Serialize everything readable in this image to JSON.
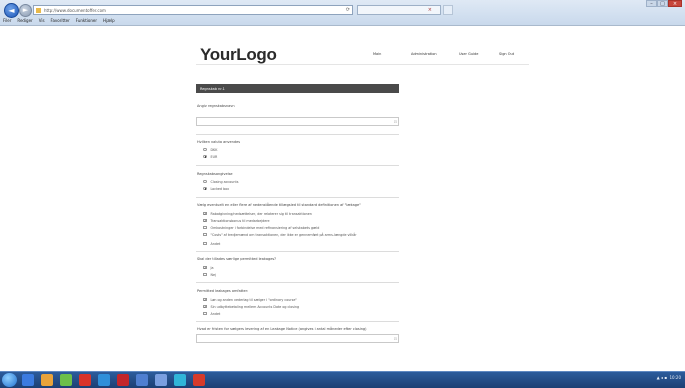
{
  "browser": {
    "back_symbol": "◄",
    "forward_symbol": "►",
    "url": "http://www.documentoffer.com",
    "tab_title": "",
    "menu": [
      "Filer",
      "Rediger",
      "Vis",
      "Favoritter",
      "Funktioner",
      "Hjælp"
    ]
  },
  "header": {
    "logo": "YourLogo",
    "nav": [
      "Main",
      "Administration",
      "User Guide",
      "Sign Out"
    ]
  },
  "form": {
    "section_title": "Regnskab nr.1",
    "q1": {
      "label": "Angiv regnskabsnavn"
    },
    "q2": {
      "label": "Hvilken valuta anvendes",
      "options": [
        "DKK",
        "EUR"
      ],
      "selected": 1
    },
    "q3": {
      "label": "Regnskabsangivelse",
      "options": [
        "Closing accounts",
        "Locked box"
      ],
      "selected": 1
    },
    "q4": {
      "label": "Vælg eventuelt en eller flere af nedenstående tillægsled til standard definitionen af \"lækage\"",
      "options": [
        {
          "text": "Rabatgivning/nedsættelser, der relaterer sig til transaktionen",
          "checked": true
        },
        {
          "text": "Transaktionsbonus til medarbejdere",
          "checked": true
        },
        {
          "text": "Omkostninger i forbindelse med refinansiering af selskabets gæld",
          "checked": false
        },
        {
          "text": "\"Costs\" af tredjemænd om transaktionen, der ikke er gennemført på arms-længde vilkår",
          "checked": false
        },
        {
          "text": "Andet",
          "checked": false
        }
      ]
    },
    "q5": {
      "label": "Skal der tillades særlige permitted leakages?",
      "options": [
        {
          "text": "Ja",
          "checked": true
        },
        {
          "text": "Nej",
          "checked": false
        }
      ]
    },
    "q6": {
      "label": "Permitted leakages omfatter:",
      "options": [
        {
          "text": "Løn og anden vederlag til sælger i \"ordinary course\"",
          "checked": true
        },
        {
          "text": "Sin udbyttebetaling mellem Accounts Date og closing",
          "checked": true
        },
        {
          "text": "Andet",
          "checked": false
        }
      ]
    },
    "q7": {
      "label": "Hvad er fristen for sælgers levering af en Leakage Notice (angives i antal måneder efter closing)"
    }
  },
  "taskbar": {
    "icon_colors": [
      "#3b7be0",
      "#e8a33b",
      "#6cc04a",
      "#d9342b",
      "#2f8fd9",
      "#c3262b",
      "#4f7fd1",
      "#7a9fe0",
      "#31b5d8",
      "#d63a2a"
    ],
    "clock": "10:20"
  }
}
